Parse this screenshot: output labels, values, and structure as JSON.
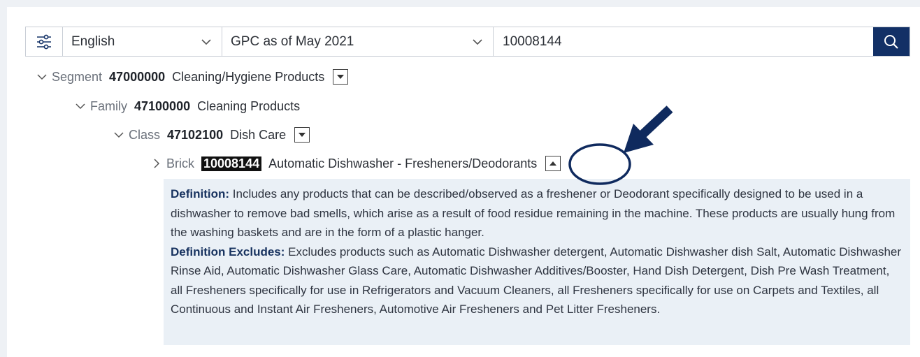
{
  "search": {
    "language": "English",
    "version": "GPC as of May 2021",
    "query": "10008144",
    "icons": {
      "filter": "sliders-icon",
      "search": "search-icon"
    }
  },
  "tree": {
    "segment": {
      "level": "Segment",
      "code": "47000000",
      "title": "Cleaning/Hygiene Products"
    },
    "family": {
      "level": "Family",
      "code": "47100000",
      "title": "Cleaning Products"
    },
    "class": {
      "level": "Class",
      "code": "47102100",
      "title": "Dish Care"
    },
    "brick": {
      "level": "Brick",
      "code": "10008144",
      "title": "Automatic Dishwasher - Fresheners/Deodorants"
    }
  },
  "definition": {
    "label": "Definition:",
    "text": "Includes any products that can be described/observed as a freshener or Deodorant specifically designed to be used in a dishwasher to remove bad smells, which arise as a result of food residue remaining in the machine. These products are usually hung from the washing baskets and are in the form of a plastic hanger.",
    "excludes_label": "Definition Excludes:",
    "excludes_text": "Excludes products such as Automatic Dishwasher detergent, Automatic Dishwasher dish Salt, Automatic Dishwasher Rinse Aid, Automatic Dishwasher Glass Care, Automatic Dishwasher Additives/Booster, Hand Dish Detergent, Dish Pre Wash Treatment, all Fresheners specifically for use in Refrigerators and Vacuum Cleaners, all Fresheners specifically for use on Carpets and Textiles, all Continuous and Instant Air Fresheners, Automotive Air Fresheners and Pet Litter Fresheners."
  },
  "colors": {
    "accent": "#123066",
    "definition_bg": "#eaf0f6",
    "annotation": "#0f2a5e"
  }
}
